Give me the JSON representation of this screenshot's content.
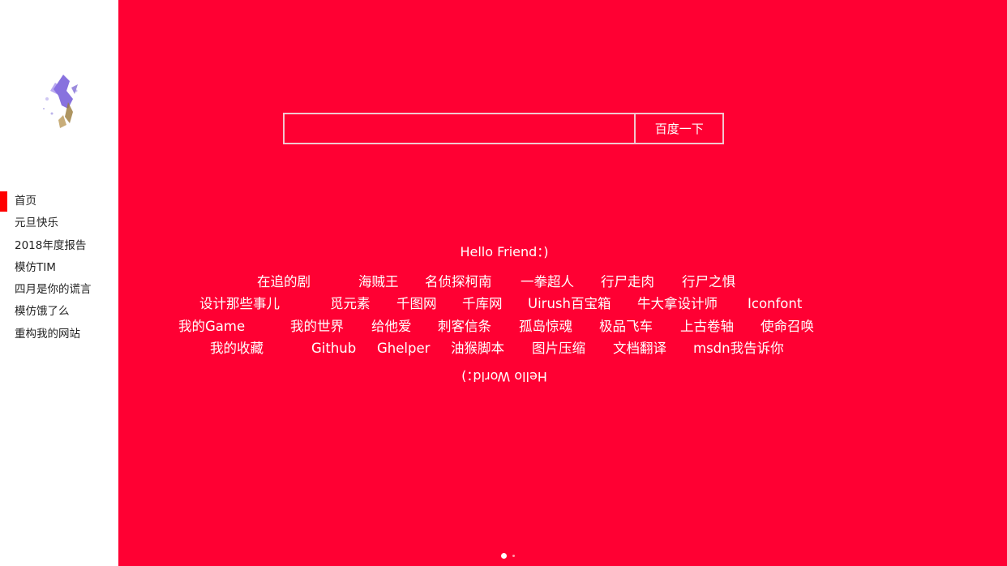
{
  "sidebar": {
    "nav_items": [
      {
        "label": "首页",
        "active": true
      },
      {
        "label": "元旦快乐"
      },
      {
        "label": "2018年度报告"
      },
      {
        "label": "模仿TIM"
      },
      {
        "label": "四月是你的谎言"
      },
      {
        "label": "模仿饿了么"
      },
      {
        "label": "重构我的网站"
      }
    ]
  },
  "main": {
    "background_color": "#ff0033",
    "search": {
      "input_value": "",
      "button_label": "百度一下"
    },
    "greeting": "Hello Friend：)",
    "farewell": "Hello World：)",
    "link_rows": [
      [
        "在追的剧",
        "海贼王",
        "名侦探柯南",
        "一拳超人",
        "行尸走肉",
        "行尸之惧"
      ],
      [
        "设计那些事儿",
        "觅元素",
        "千图网",
        "千库网",
        "Uirush百宝箱",
        "牛大拿设计师",
        "Iconfont"
      ],
      [
        "我的Game",
        "我的世界",
        "给他爱",
        "刺客信条",
        "孤岛惊魂",
        "极品飞车",
        "上古卷轴",
        "使命召唤"
      ],
      [
        "我的收藏",
        "Github",
        "Ghelper",
        "油猴脚本",
        "图片压缩",
        "文档翻译",
        "msdn我告诉你"
      ]
    ],
    "pagination": {
      "current": 1,
      "total": 2
    }
  }
}
